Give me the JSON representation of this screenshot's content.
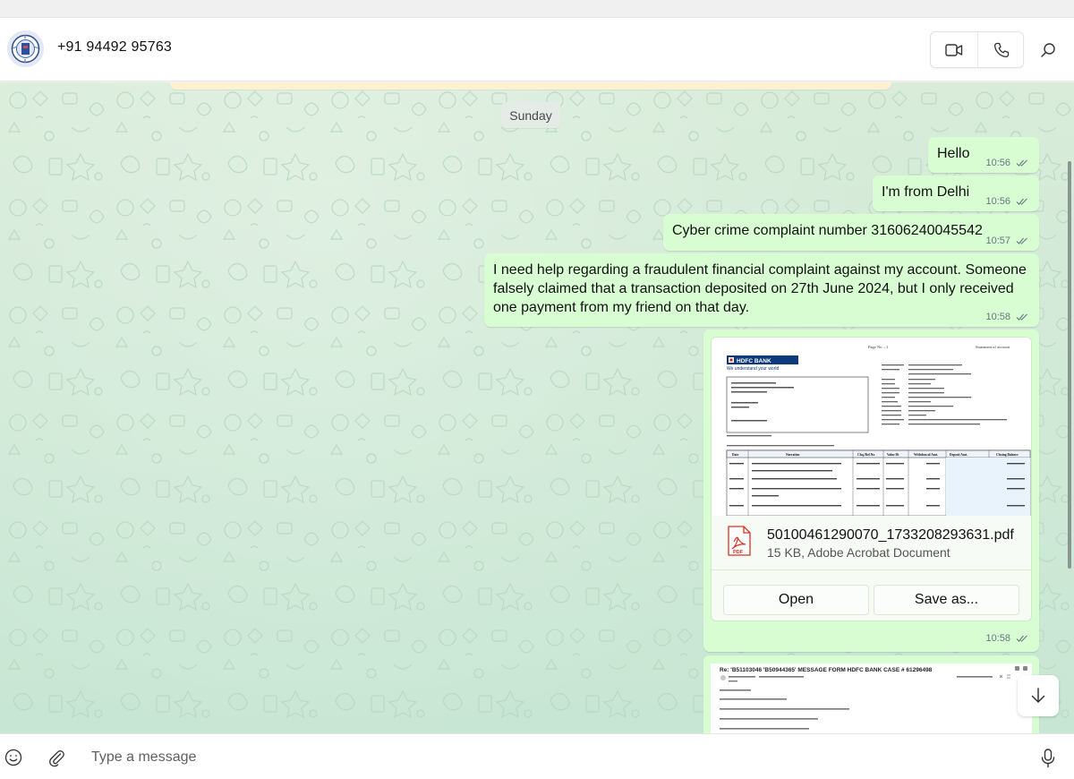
{
  "header": {
    "contact_name": "+91 94492 95763",
    "video_call_icon": "video-camera-icon",
    "voice_call_icon": "phone-icon",
    "search_icon": "search-icon"
  },
  "chat": {
    "date_separator": "Sunday",
    "messages": [
      {
        "text": "Hello",
        "time": "10:56",
        "status": "read"
      },
      {
        "text": "I'm from Delhi",
        "time": "10:56",
        "status": "read"
      },
      {
        "text": "Cyber crime complaint number 31606240045542",
        "time": "10:57",
        "status": "read"
      },
      {
        "text": "I need help regarding a fraudulent financial complaint against my account. Someone falsely claimed that a transaction deposited on 27th June 2024, but I only received one payment from my friend on that day.",
        "time": "10:58",
        "status": "read"
      }
    ],
    "file_message": {
      "file_name": "50100461290070_1733208293631.pdf",
      "file_meta": "15 KB, Adobe Acrobat Document",
      "open_label": "Open",
      "save_label": "Save as...",
      "time": "10:58",
      "status": "read",
      "preview": {
        "page_no": "Page No .:  1",
        "statement_title": "Statement of account",
        "bank_name": "HDFC BANK",
        "tagline": "We understand your world",
        "columns": [
          "Date",
          "Narration",
          "Chq./Ref.No.",
          "Value Dt",
          "Withdrawal Amt.",
          "Deposit Amt.",
          "Closing Balance"
        ]
      }
    },
    "image_message": {
      "subject": "Re: 'B51103046 'B50944365' MESSAGE FORM HDFC BANK CASE # 61296498"
    }
  },
  "composer": {
    "placeholder": "Type a message",
    "emoji_icon": "emoji-icon",
    "attach_icon": "paperclip-icon",
    "mic_icon": "microphone-icon"
  },
  "colors": {
    "outgoing_bubble": "#d9fdd3",
    "chat_background": "#d4ebd8",
    "read_tick": "#667781"
  }
}
